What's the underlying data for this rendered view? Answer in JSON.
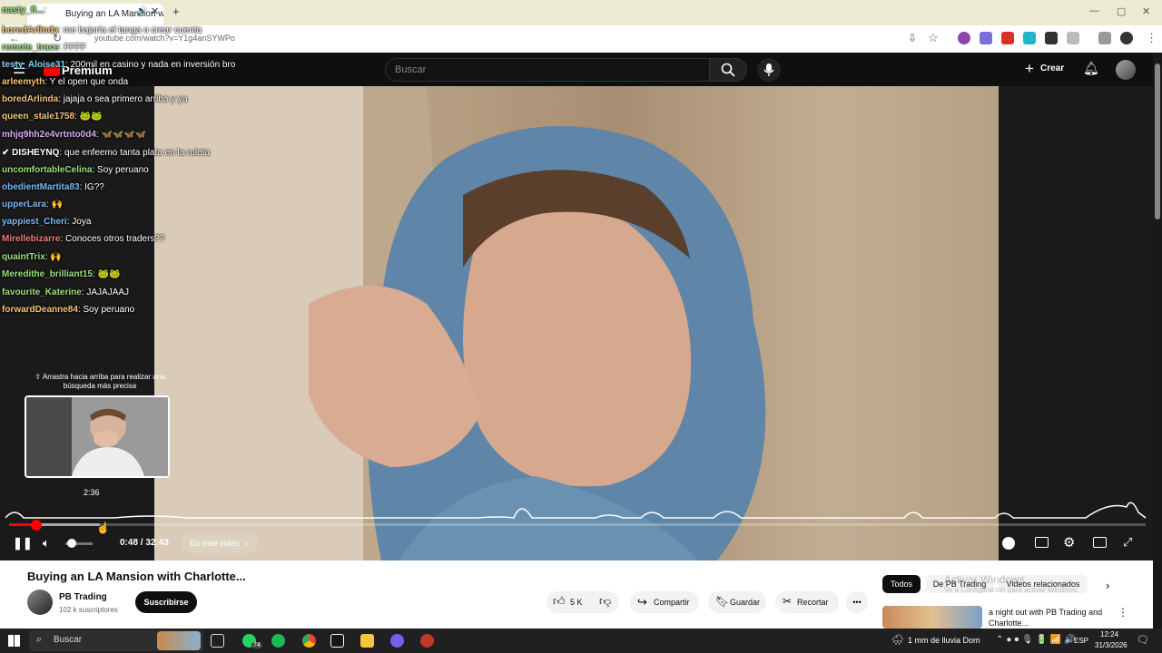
{
  "browser": {
    "tab_title": "Buying an LA Mansion with",
    "url": "youtube.com/watch?v=Y1g4anSYWPo"
  },
  "header": {
    "logo_label": "Premium",
    "search_placeholder": "Buscar",
    "create_label": "Crear"
  },
  "chat": [
    {
      "user": "nasty_fl...",
      "text": "",
      "color": "#9be07a"
    },
    {
      "user": "boredArlinda",
      "text": "me bajaría el tanga o crear cuenta",
      "color": "#f1c27a"
    },
    {
      "user": "remote_trace",
      "text": "FFFF",
      "color": "#9be07a"
    },
    {
      "user": "testy_Aloise31",
      "text": "200mil en casino y nada en inversión bro",
      "color": "#7ad3f1"
    },
    {
      "user": "arleemyth",
      "text": "Y el open que onda",
      "color": "#f1c27a"
    },
    {
      "user": "boredArlinda",
      "text": "jajaja o sea primero arriba y ya",
      "color": "#f1c27a"
    },
    {
      "user": "queen_stale1758",
      "text": "🐸🐸",
      "color": "#f1c27a"
    },
    {
      "user": "mhjq9hh2e4vrtnto0d4",
      "text": "🦋🦋🦋🦋",
      "color": "#d8a8f0"
    },
    {
      "user": "✔ DISHEYNQ",
      "text": "que enfeemo tanta plata en la ruleta",
      "color": "#ffffff"
    },
    {
      "user": "uncomfortableCelina",
      "text": "Soy peruano",
      "color": "#9be07a"
    },
    {
      "user": "obedientMartita83",
      "text": "IG??",
      "color": "#7ab8f1"
    },
    {
      "user": "upperLara",
      "text": "🙌",
      "color": "#7ab8f1"
    },
    {
      "user": "yappiest_Cheri",
      "text": "Joya",
      "color": "#7ab8f1"
    },
    {
      "user": "Mirellebizarre",
      "text": "Conoces otros traders??",
      "color": "#f17a7a"
    },
    {
      "user": "quaintTrix",
      "text": "🙌",
      "color": "#9be07a"
    },
    {
      "user": "Meredithe_brilliant15",
      "text": "🐸🐸",
      "color": "#9be07a"
    },
    {
      "user": "favourite_Katerine",
      "text": "JAJAJAAJ",
      "color": "#9be07a"
    },
    {
      "user": "forwardDeanne84",
      "text": "Soy peruano",
      "color": "#f1c27a"
    }
  ],
  "player": {
    "seek_hint": "⇧ Arrastra hacia arriba para realizar una búsqueda más precisa",
    "preview_time": "2:36",
    "current_time": "0:48",
    "duration": "32:43",
    "time_sep": " / ",
    "chapter_label": "En este video",
    "progress_played": 0.024,
    "progress_buffered": 0.08
  },
  "video_info": {
    "title": "Buying an LA Mansion with Charlotte...",
    "channel": "PB Trading",
    "subscribers": "102 k suscriptores",
    "subscribe_label": "Suscribirse",
    "likes": "5 K",
    "share_label": "Compartir",
    "save_label": "Guardar",
    "clip_label": "Recortar"
  },
  "related": {
    "chips": [
      "Todos",
      "De PB Trading",
      "Videos relacionados"
    ],
    "watermark_line1": "Activar Windows",
    "watermark_line2": "Ve a Configuración para activar Windows.",
    "first_title": "a night out with PB Trading and Charlotte..."
  },
  "taskbar": {
    "search_placeholder": "Buscar",
    "badge": "74",
    "weather": "1 mm de lluvia Dom",
    "lang": "ESP",
    "time": "12:24",
    "date": "31/3/2026"
  },
  "colors": {
    "accent": "#ff0000",
    "yt_bg": "#0f0f0f"
  }
}
